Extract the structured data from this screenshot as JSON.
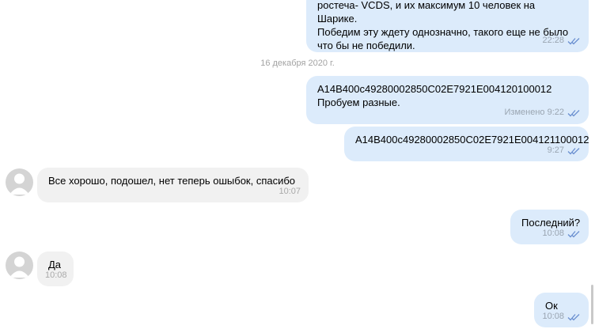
{
  "date_separator": "16 декабря 2020 г.",
  "colors": {
    "outgoing_bubble": "#dcebfb",
    "incoming_bubble": "#f1f1f1",
    "read_check": "#6a8fd0"
  },
  "messages": [
    {
      "direction": "outgoing",
      "text": "ростеча- VCDS, и их максимум 10 человек на Шарике.\nПобедим эту ждету однозначно, такого еще не было\nчто бы не победили.",
      "meta": "22:28",
      "read": true
    },
    {
      "direction": "outgoing",
      "text": "A14B400c49280002850C02E7921E004120100012\nПробуем разные.",
      "meta": "Изменено 9:22",
      "read": true
    },
    {
      "direction": "outgoing",
      "text": "A14B400c49280002850C02E7921E004121100012",
      "meta": "9:27",
      "read": true
    },
    {
      "direction": "incoming",
      "text": "Все хорошо, подошел, нет теперь ошыбок, спасибо",
      "meta": "10:07",
      "avatar_icon": "user-avatar-icon"
    },
    {
      "direction": "outgoing",
      "text": "Последний?",
      "meta": "10:08",
      "read": true
    },
    {
      "direction": "incoming",
      "text": "Да",
      "meta": "10:08",
      "avatar_icon": "user-avatar-icon"
    },
    {
      "direction": "outgoing",
      "text": "Ок",
      "meta": "10:08",
      "read": true
    }
  ]
}
